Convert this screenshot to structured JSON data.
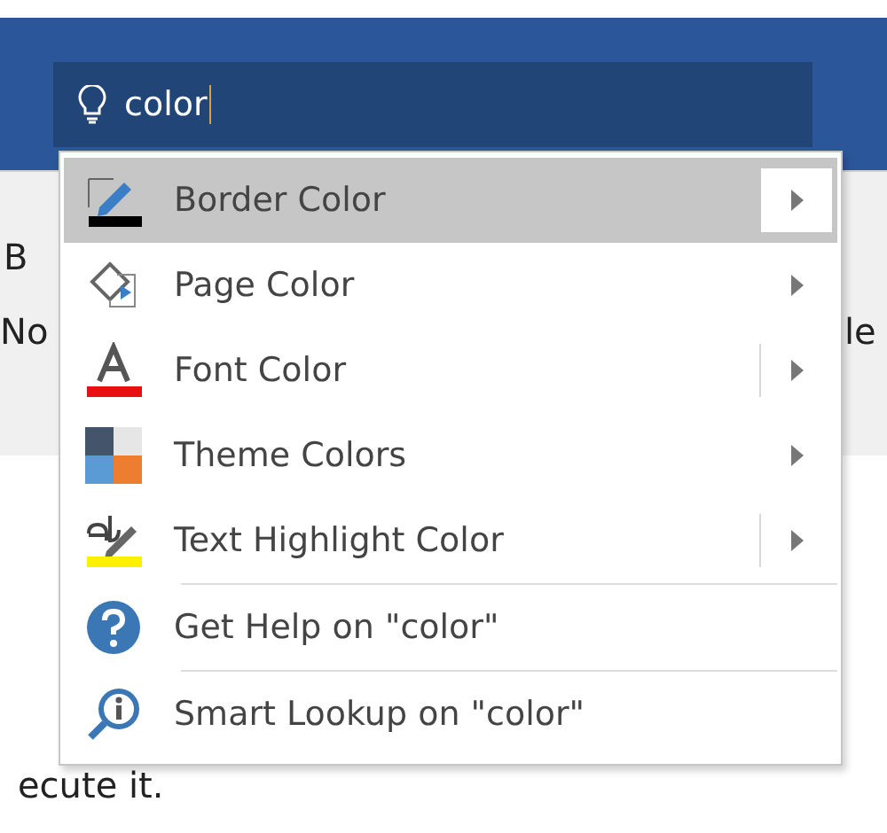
{
  "search": {
    "value": "color"
  },
  "background_fragments": [
    "B",
    "No",
    "le",
    "ecute it."
  ],
  "menu": {
    "items": [
      {
        "label": "Border Color",
        "kind": "submenu",
        "split": false,
        "selected": true
      },
      {
        "label": "Page Color",
        "kind": "submenu",
        "split": false,
        "selected": false
      },
      {
        "label": "Font Color",
        "kind": "submenu",
        "split": true,
        "selected": false
      },
      {
        "label": "Theme Colors",
        "kind": "submenu",
        "split": false,
        "selected": false
      },
      {
        "label": "Text Highlight Color",
        "kind": "submenu",
        "split": true,
        "selected": false
      },
      {
        "label": "Get Help on \"color\"",
        "kind": "action",
        "split": false,
        "selected": false
      },
      {
        "label": "Smart Lookup on \"color\"",
        "kind": "action",
        "split": false,
        "selected": false
      }
    ]
  }
}
